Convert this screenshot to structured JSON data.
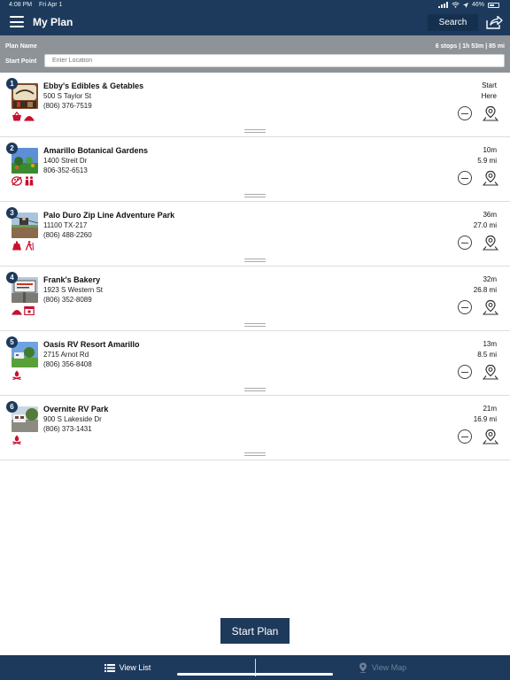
{
  "status_bar": {
    "time": "4:08 PM",
    "date": "Fri Apr 1",
    "battery": "46%"
  },
  "header": {
    "title": "My Plan",
    "search_label": "Search"
  },
  "plan": {
    "name_label": "Plan Name",
    "stats": "6 stops | 1h 53m | 85 mi",
    "start_point_label": "Start Point",
    "start_point_placeholder": "Enter Location"
  },
  "stops": [
    {
      "num": "1",
      "name": "Ebby's Edibles & Getables",
      "address": "500 S Taylor St",
      "phone": "(806) 376-7519",
      "time": "Start",
      "distance": "Here"
    },
    {
      "num": "2",
      "name": "Amarillo Botanical Gardens",
      "address": "1400 Streit Dr",
      "phone": "806-352-6513",
      "time": "10m",
      "distance": "5.9 mi"
    },
    {
      "num": "3",
      "name": "Palo Duro Zip Line Adventure Park",
      "address": "11100 TX-217",
      "phone": "(806) 488-2260",
      "time": "36m",
      "distance": "27.0 mi"
    },
    {
      "num": "4",
      "name": "Frank's Bakery",
      "address": "1923 S Western St",
      "phone": "(806) 352-8089",
      "time": "32m",
      "distance": "26.8 mi"
    },
    {
      "num": "5",
      "name": "Oasis RV Resort Amarillo",
      "address": "2715 Arnot Rd",
      "phone": "(806) 356-8408",
      "time": "13m",
      "distance": "8.5 mi"
    },
    {
      "num": "6",
      "name": "Overnite RV Park",
      "address": "900 S Lakeside Dr",
      "phone": "(806) 373-1431",
      "time": "21m",
      "distance": "16.9 mi"
    }
  ],
  "actions": {
    "start_plan_label": "Start Plan"
  },
  "tabs": {
    "list_label": "View List",
    "map_label": "View Map"
  },
  "colors": {
    "primary": "#1d3a5c",
    "accent_red": "#c8102e",
    "header_gray": "#8e9398"
  }
}
